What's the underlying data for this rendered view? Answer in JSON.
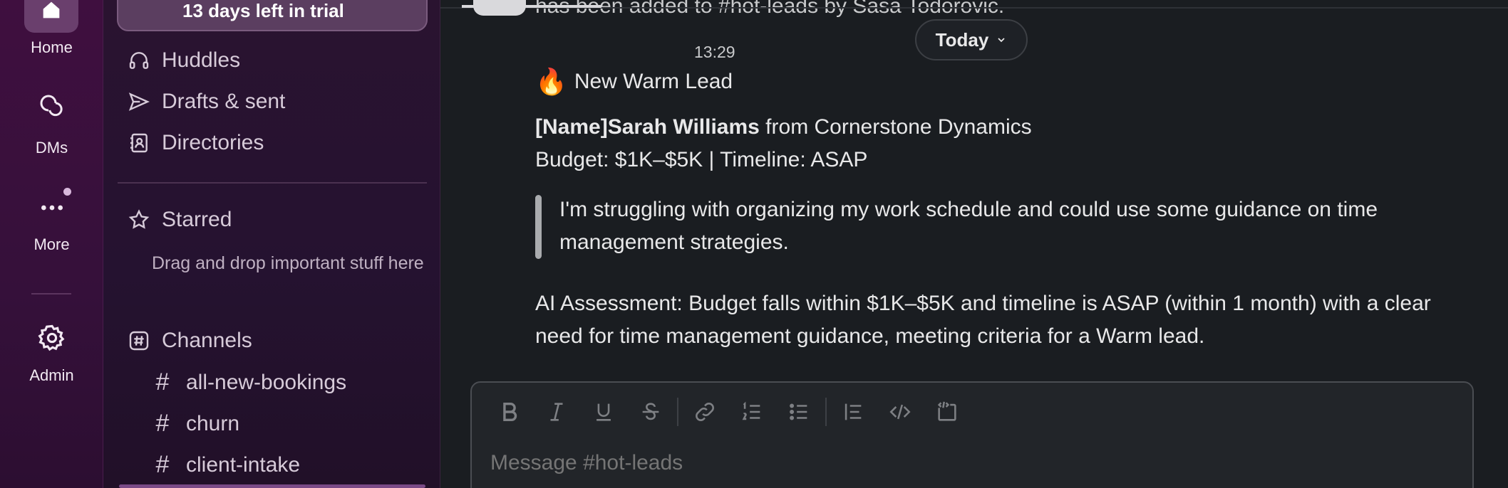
{
  "rail": {
    "home_label": "Home",
    "dms_label": "DMs",
    "more_label": "More",
    "admin_label": "Admin"
  },
  "sidebar": {
    "trial_label": "13 days left in trial",
    "nav": [
      {
        "label": "Huddles",
        "icon": "headphones-icon"
      },
      {
        "label": "Drafts & sent",
        "icon": "send-icon"
      },
      {
        "label": "Directories",
        "icon": "contacts-icon"
      }
    ],
    "starred_label": "Starred",
    "starred_hint": "Drag and drop important stuff here",
    "channels_label": "Channels",
    "channels": [
      "all-new-bookings",
      "churn",
      "client-intake"
    ]
  },
  "main": {
    "system_message": "has been added to #hot-leads by Sasa Todorovic.",
    "timestamp": "13:29",
    "today_label": "Today",
    "heading_emoji": "🔥",
    "heading": "New Warm Lead",
    "name_prefix": "[Name]Sarah Williams",
    "company": " from Cornerstone Dynamics",
    "budget_line": "Budget: $1K–$5K | Timeline: ASAP",
    "quote": "I'm struggling with organizing my work schedule and could use some guidance on time management strategies.",
    "assessment": "AI Assessment: Budget falls within $1K–$5K and timeline is ASAP (within 1 month) with a clear need for time management guidance, meeting criteria for a Warm lead."
  },
  "composer": {
    "placeholder": "Message #hot-leads"
  },
  "colors": {
    "rail_bg": "#3f0f3f",
    "sidebar_bg": "#2a1330",
    "main_bg": "#1a1d21",
    "text": "#e8e8e9"
  }
}
